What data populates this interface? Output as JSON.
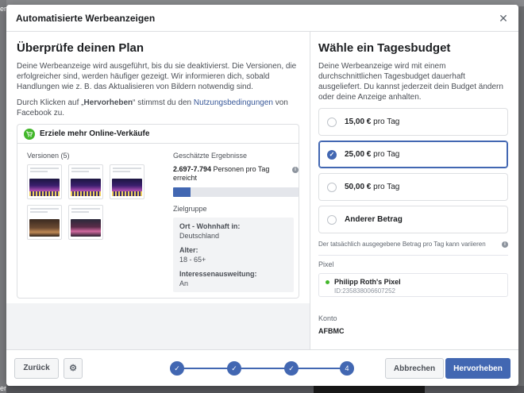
{
  "backdrop": {
    "left_text_top": "er",
    "left_text_bottom": "er"
  },
  "dialog": {
    "title": "Automatisierte Werbeanzeigen",
    "close_icon": "close-icon"
  },
  "plan": {
    "heading": "Überprüfe deinen Plan",
    "description": "Deine Werbeanzeige wird ausgeführt, bis du sie deaktivierst. Die Versionen, die erfolgreicher sind, werden häufiger gezeigt. Wir informieren dich, sobald Handlungen wie z. B. das Aktualisieren von Bildern notwendig sind.",
    "terms_prefix": "Durch Klicken auf „",
    "terms_bold": "Hervorheben",
    "terms_middle": "“ stimmst du den ",
    "terms_link": "Nutzungsbedingungen",
    "terms_suffix": " von Facebook zu."
  },
  "card": {
    "objective": "Erziele mehr Online-Verkäufe",
    "objective_icon": "shopping-cart-icon",
    "versions_label": "Versionen (5)",
    "versions": [
      {
        "image": "concert-stage"
      },
      {
        "image": "concert-stage"
      },
      {
        "image": "concert-stage"
      },
      {
        "image": "restaurant-room"
      },
      {
        "image": "event-hall"
      }
    ],
    "estimates_label": "Geschätzte Ergebnisse",
    "estimate_range": "2.697-7.794",
    "estimate_unit": " Personen pro Tag erreicht",
    "estimate_fill_fraction": 0.14,
    "audience_label": "Zielgruppe",
    "audience": [
      {
        "label": "Ort - Wohnhaft in:",
        "value": "Deutschland"
      },
      {
        "label": "Alter:",
        "value": "18 - 65+"
      },
      {
        "label": "Interessenausweitung:",
        "value": "An"
      }
    ]
  },
  "budget": {
    "heading": "Wähle ein Tagesbudget",
    "description": "Deine Werbeanzeige wird mit einem durchschnittlichen Tagesbudget dauerhaft ausgeliefert. Du kannst jederzeit dein Budget ändern oder deine Anzeige anhalten.",
    "options": [
      {
        "amount": "15,00 €",
        "suffix": " pro Tag",
        "selected": false
      },
      {
        "amount": "25,00 €",
        "suffix": " pro Tag",
        "selected": true
      },
      {
        "amount": "50,00 €",
        "suffix": " pro Tag",
        "selected": false
      },
      {
        "amount": "Anderer Betrag",
        "suffix": "",
        "selected": false
      }
    ],
    "note": "Der tatsächlich ausgegebene Betrag pro Tag kann variieren",
    "pixel_label": "Pixel",
    "pixel_name": "Philipp Roth's Pixel",
    "pixel_id": "ID:235838006607252",
    "account_label": "Konto",
    "account_value": "AFBMC"
  },
  "footer": {
    "back_label": "Zurück",
    "gear_icon": "gear-icon",
    "steps": [
      "✓",
      "✓",
      "✓",
      "4"
    ],
    "cancel_label": "Abbrechen",
    "submit_label": "Hervorheben"
  },
  "colors": {
    "accent": "#4267b2",
    "success": "#42b72a"
  }
}
